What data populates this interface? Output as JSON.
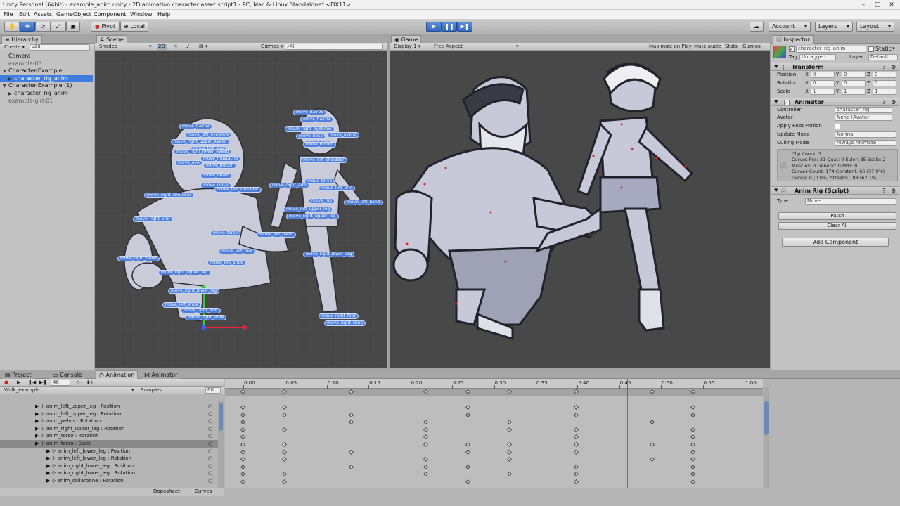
{
  "window": {
    "title": "Unity Personal (64bit) - example_anim.unity - 2D animation character asset script1 - PC, Mac & Linux Standalone* <DX11>",
    "minimize": "–",
    "maximize": "□",
    "close": "✕"
  },
  "menu": [
    "File",
    "Edit",
    "Assets",
    "GameObject",
    "Component",
    "Window",
    "Help"
  ],
  "toolbar": {
    "pivot": "Pivot",
    "local": "Local",
    "account": "Account",
    "layers": "Layers",
    "layout": "Layout",
    "cloud_icon": "cloud-icon"
  },
  "hierarchy": {
    "tab": "Hierarchy",
    "create": "Create",
    "search_placeholder": "All",
    "items": [
      {
        "label": "Camera",
        "indent": 0,
        "state": "normal"
      },
      {
        "label": "example-03",
        "indent": 0,
        "state": "dim"
      },
      {
        "label": "Character-Example",
        "indent": 0,
        "state": "normal",
        "arrow": "▼"
      },
      {
        "label": "character_rig_anim",
        "indent": 1,
        "state": "selected",
        "arrow": "▶"
      },
      {
        "label": "Character-Example (1)",
        "indent": 0,
        "state": "normal",
        "arrow": "▼"
      },
      {
        "label": "character_rig_anim",
        "indent": 1,
        "state": "normal",
        "arrow": "▶"
      },
      {
        "label": "example-girl-01",
        "indent": 0,
        "state": "dim"
      }
    ]
  },
  "scene": {
    "tab": "Scene",
    "shading": "Shaded",
    "mode_2d": "2D",
    "gizmos": "Gizmos",
    "search_placeholder": "All",
    "bones_man": [
      "move_hair02",
      "move_left_eyebrow",
      "move_right_upper_eyelid",
      "move_left_eye",
      "move_right_lower_eyelid",
      "move_eye",
      "move_mustache",
      "move_mouth",
      "move_beard",
      "move_collar",
      "move_left_shoulder",
      "move_right_shoulder",
      "move_right_arm",
      "move_torso",
      "move_left_hand",
      "move_left_foot",
      "move_left_shoe",
      "move_right_hand",
      "move_right_upper_leg",
      "move_right_lower_leg",
      "move_left_shoe",
      "move_right_foot",
      "move_right_shoe"
    ],
    "bones_girl": [
      "move_hair03",
      "move_hair01",
      "move_right_eyebrow",
      "move_nose",
      "move_ear",
      "move_eyelid",
      "move_mouth",
      "move_left_shoulder",
      "move_torso",
      "move_right_arm",
      "move_left_arm",
      "move_hip",
      "move_left_hand",
      "move_left_upper_leg",
      "move_right_upper_leg",
      "move_right_lower_leg",
      "move_right_foot",
      "move_right_shoe"
    ]
  },
  "game": {
    "tab": "Game",
    "display": "Display 1",
    "aspect": "Free Aspect",
    "options": [
      "Maximize on Play",
      "Mute audio",
      "Stats",
      "Gizmos"
    ]
  },
  "inspector": {
    "tab": "Inspector",
    "object_name": "character_rig_anim",
    "static": "Static",
    "tag_label": "Tag",
    "tag": "Untagged",
    "layer_label": "Layer",
    "layer": "Default",
    "transform": {
      "title": "Transform",
      "rows": [
        {
          "label": "Position",
          "x": "0",
          "y": "0",
          "z": "0"
        },
        {
          "label": "Rotation",
          "x": "0",
          "y": "0",
          "z": "0"
        },
        {
          "label": "Scale",
          "x": "1",
          "y": "1",
          "z": "1"
        }
      ]
    },
    "animator": {
      "title": "Animator",
      "controller_label": "Controller",
      "controller": "character_rig",
      "avatar_label": "Avatar",
      "avatar": "None (Avatar)",
      "root_motion_label": "Apply Root Motion",
      "update_label": "Update Mode",
      "update": "Normal",
      "culling_label": "Culling Mode",
      "culling": "Always Animate",
      "info": [
        "Clip Count: 3",
        "Curves Pos: 21 Quat: 0 Euler: 35 Scale: 2",
        "Muscles: 0 Generic: 0 PPtr: 0",
        "Curves Count: 174 Constant: 66 (37.9%)",
        "Dense: 0 (0.0%) Stream: 108 (62.1%)"
      ]
    },
    "script": {
      "title": "Anim Rig (Script)",
      "type_label": "Type",
      "type": "Move",
      "patch": "Patch",
      "clear": "Clear All"
    },
    "add_component": "Add Component"
  },
  "bottom": {
    "tabs": [
      "Project",
      "Console",
      "Animation",
      "Animator"
    ],
    "frame": "46",
    "clip": "Walk_example",
    "samples_label": "Samples",
    "samples": "60",
    "time_labels": [
      "0:00",
      "0:05",
      "0:10",
      "0:15",
      "0:20",
      "0:25",
      "0:30",
      "0:35",
      "0:40",
      "0:45",
      "0:50",
      "0:55",
      "1:00"
    ],
    "properties": [
      {
        "label": "anim_left_upper_leg : Position",
        "level": 1
      },
      {
        "label": "anim_left_upper_leg : Rotation",
        "level": 1
      },
      {
        "label": "anim_pelvis : Rotation",
        "level": 1
      },
      {
        "label": "anim_right_upper_leg : Rotation",
        "level": 1
      },
      {
        "label": "anim_torso : Rotation",
        "level": 1
      },
      {
        "label": "anim_torso : Scale",
        "level": 1,
        "selected": true
      },
      {
        "label": "anim_left_lower_leg : Position",
        "level": 2
      },
      {
        "label": "anim_left_lower_leg : Rotation",
        "level": 2
      },
      {
        "label": "anim_right_lower_leg : Position",
        "level": 2
      },
      {
        "label": "anim_right_lower_leg : Rotation",
        "level": 2
      },
      {
        "label": "anim_collarbone : Rotation",
        "level": 2
      }
    ],
    "dopesheet": "Dopesheet",
    "curves": "Curves"
  }
}
